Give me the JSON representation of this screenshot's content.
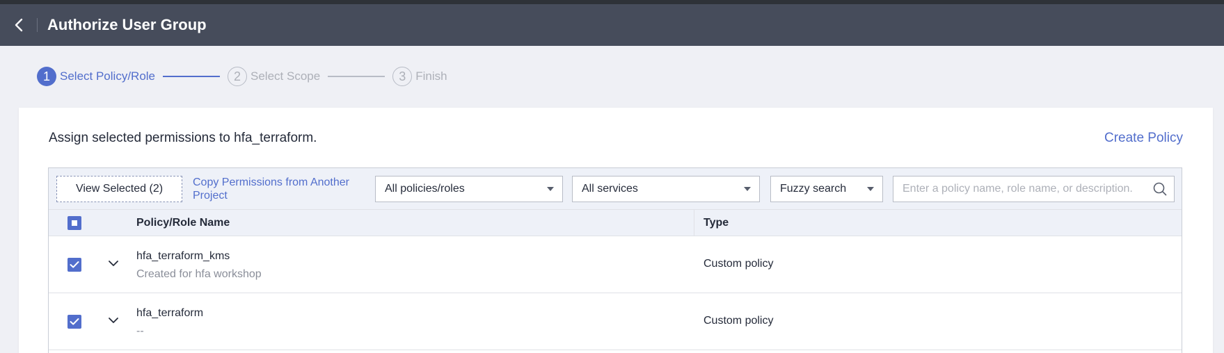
{
  "header": {
    "title": "Authorize User Group"
  },
  "steps": [
    {
      "number": "1",
      "label": "Select Policy/Role"
    },
    {
      "number": "2",
      "label": "Select Scope"
    },
    {
      "number": "3",
      "label": "Finish"
    }
  ],
  "card": {
    "assign_text": "Assign selected permissions to hfa_terraform.",
    "create_policy": "Create Policy"
  },
  "toolbar": {
    "view_selected": "View Selected (2)",
    "copy_permissions": "Copy Permissions from Another Project",
    "policy_filter": "All policies/roles",
    "service_filter": "All services",
    "search_mode": "Fuzzy search",
    "search_placeholder": "Enter a policy name, role name, or description."
  },
  "table": {
    "columns": [
      "Policy/Role Name",
      "Type"
    ],
    "rows": [
      {
        "name": "hfa_terraform_kms",
        "description": "Created for hfa workshop",
        "type": "Custom policy"
      },
      {
        "name": "hfa_terraform",
        "description": "--",
        "type": "Custom policy"
      }
    ]
  },
  "colors": {
    "accent": "#526ecc",
    "header_bg": "#464c5b",
    "page_bg": "#eff0f5"
  }
}
